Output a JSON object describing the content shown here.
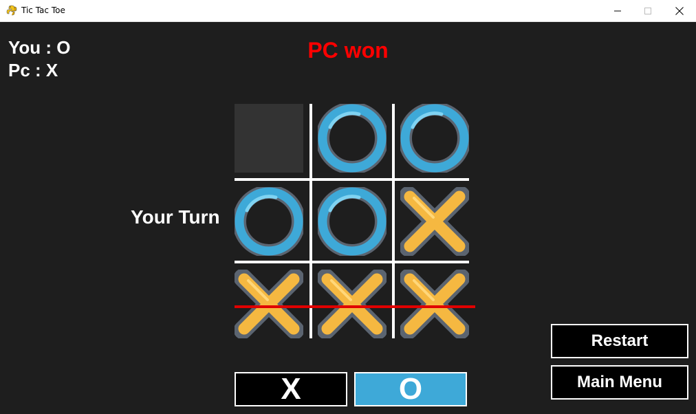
{
  "window": {
    "title": "Tic Tac Toe",
    "controls": [
      "minimize",
      "maximize",
      "close"
    ]
  },
  "score": {
    "you": "You : O",
    "pc": "Pc : X"
  },
  "status": "PC won",
  "turn_label": "Your Turn",
  "board": [
    [
      "",
      "O",
      "O"
    ],
    [
      "O",
      "O",
      "X"
    ],
    [
      "X",
      "X",
      "X"
    ]
  ],
  "winning_row": 3,
  "buttons": {
    "restart": "Restart",
    "main_menu": "Main Menu"
  },
  "symbol_choice": {
    "x_label": "X",
    "o_label": "O",
    "selected": "O"
  },
  "colors": {
    "background": "#1e1e1e",
    "status": "#ff0000",
    "win_line": "#e00000",
    "o_piece": "#3ea9d8",
    "x_piece": "#f5b841",
    "selected_choice": "#3ea9d8"
  }
}
